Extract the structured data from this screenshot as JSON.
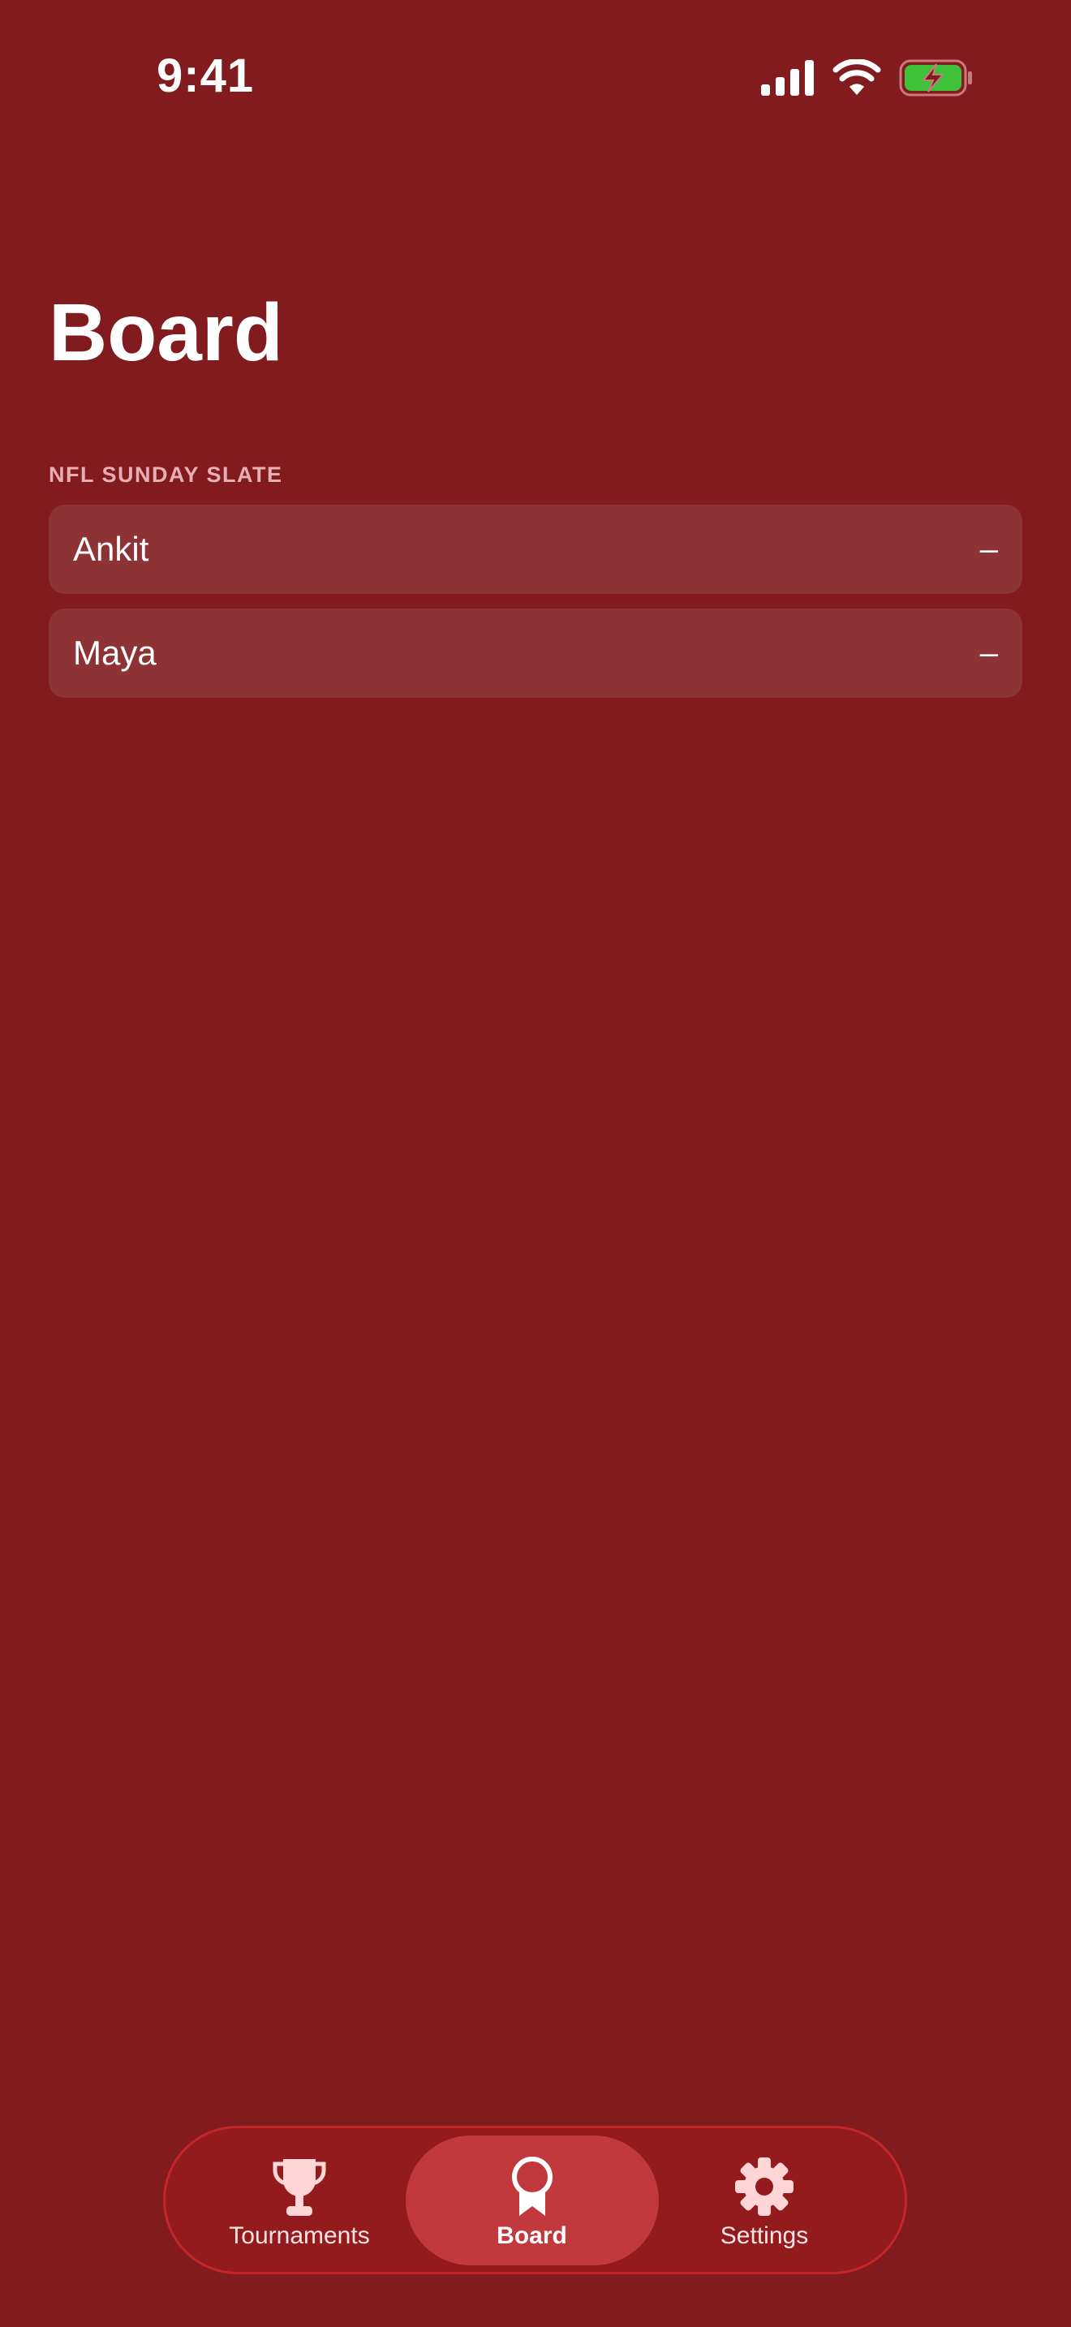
{
  "status_bar": {
    "time": "9:41",
    "icons": [
      "cellular-signal-icon",
      "wifi-icon",
      "battery-charging-icon"
    ],
    "battery_color": "#3ec23a"
  },
  "page": {
    "title": "Board"
  },
  "section": {
    "header": "NFL SUNDAY SLATE",
    "players": [
      {
        "name": "Ankit",
        "score": "–"
      },
      {
        "name": "Maya",
        "score": "–"
      }
    ]
  },
  "tab_bar": {
    "tabs": [
      {
        "label": "Tournaments",
        "icon": "trophy-icon",
        "active": false
      },
      {
        "label": "Board",
        "icon": "medal-icon",
        "active": true
      },
      {
        "label": "Settings",
        "icon": "gear-icon",
        "active": false
      }
    ]
  },
  "colors": {
    "background": "#821b1e",
    "row": "#8d3336",
    "tab_bar": "#931a1d",
    "tab_active": "#c1393c",
    "section_header": "#e6b0b2"
  }
}
